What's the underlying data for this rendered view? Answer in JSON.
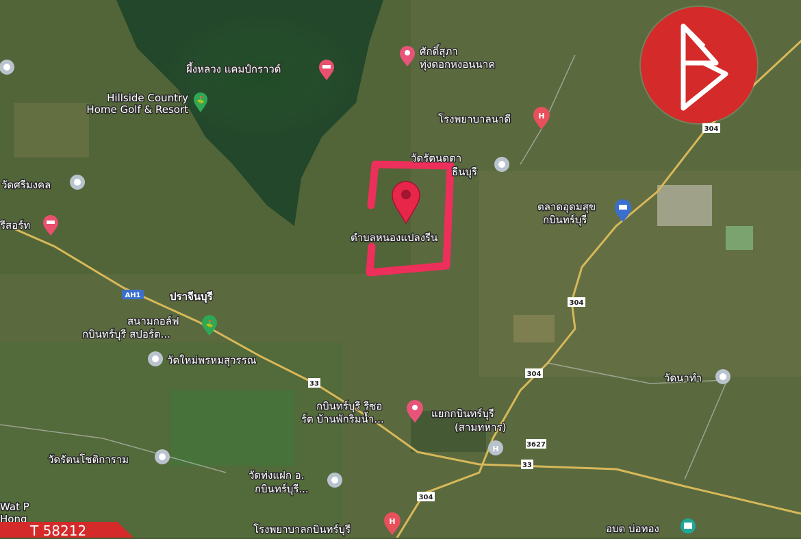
{
  "map": {
    "places": [
      {
        "id": "hillside",
        "label": "Hillside Country\nHome Golf & Resort",
        "type": "golf"
      },
      {
        "id": "phueng",
        "label": "ผึ้งหลวง แคมป์กราวด์",
        "type": "lodging"
      },
      {
        "id": "saksit",
        "label": "ศักดิ์สุภา\nทุ่งดอกหงอนนาค",
        "type": "shopping"
      },
      {
        "id": "nadi",
        "label": "โรงพยาบาลนาดี",
        "type": "hospital"
      },
      {
        "id": "wat_rat",
        "label": "วัดรัตนดตา\nธีนบุรี",
        "type": "temple"
      },
      {
        "id": "wat_srimongkol",
        "label": "วัดศรีมงคล",
        "type": "temple"
      },
      {
        "id": "resort",
        "label": "รีสอร์ท",
        "type": "lodging"
      },
      {
        "id": "target",
        "label": "ตำบลหนองแปลงรีน",
        "type": "pin"
      },
      {
        "id": "market",
        "label": "ตลาดอุดมสุข\nกบินทร์บุรี",
        "type": "shopping"
      },
      {
        "id": "prachinburi",
        "label": "ปราจีนบุรี",
        "type": "province"
      },
      {
        "id": "golf_kabin",
        "label": "สนามกอล์ฟ\nกบินทร์บุรี สปอร์ต...",
        "type": "golf"
      },
      {
        "id": "wat_mai",
        "label": "วัดใหม่พรหมสุวรรณ",
        "type": "temple"
      },
      {
        "id": "wat_natham",
        "label": "วัดนาทำ",
        "type": "temple"
      },
      {
        "id": "kabin_rs",
        "label": "กบินทร์บุรี รีซอ\nร์ต บ้านพักริมน้ำ...",
        "type": "shopping"
      },
      {
        "id": "junction",
        "label": "แยกกบินทร์บุรี\n(สามทหาร)",
        "type": "transit"
      },
      {
        "id": "wat_ratchot",
        "label": "วัดรัตนโชติการาม",
        "type": "temple"
      },
      {
        "id": "wat_thongfak",
        "label": "วัดท่งแฝก อ.\nกบินทร์บุรี...",
        "type": "temple"
      },
      {
        "id": "kabin_hosp",
        "label": "โรงพยาบาลกบินทร์บุรี",
        "type": "hospital"
      },
      {
        "id": "obt",
        "label": "อบต บ่อทอง",
        "type": "government"
      },
      {
        "id": "watp",
        "label": "Wat P\nHong",
        "type": "temple"
      }
    ],
    "roads": [
      "AH1",
      "304",
      "304",
      "304",
      "33",
      "33",
      "304",
      "3627"
    ],
    "colors": {
      "pin": "#e8264a",
      "hospital": "#e8505b",
      "temple": "#b9c3cd",
      "golf": "#2fa856",
      "lodging": "#e8506e",
      "shopping": "#e8537a",
      "highlight": "#ec2f5b",
      "road": "#d8b85a",
      "brand": "#d42a2a"
    }
  },
  "listing": {
    "code": "T 58212"
  }
}
